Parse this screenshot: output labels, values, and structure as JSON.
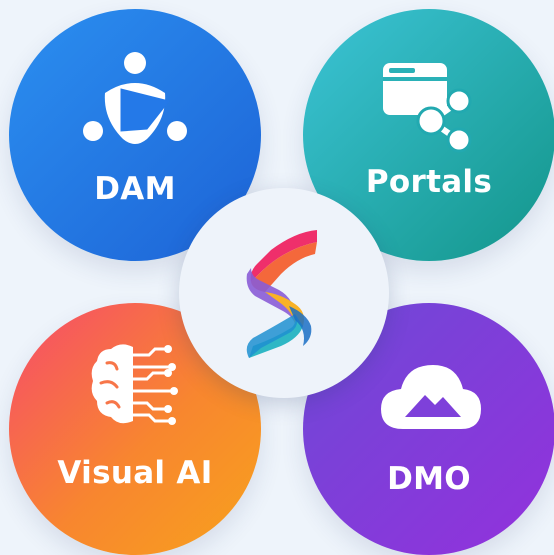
{
  "nodes": {
    "dam": {
      "label": "DAM",
      "icon": "people-play-icon"
    },
    "portals": {
      "label": "Portals",
      "icon": "browser-share-icon"
    },
    "visual_ai": {
      "label": "Visual AI",
      "icon": "brain-circuit-icon"
    },
    "dmo": {
      "label": "DMO",
      "icon": "cloud-image-icon"
    }
  },
  "center": {
    "icon": "brand-s-logo"
  },
  "colors": {
    "background": "#eef4fb",
    "dam": [
      "#2b8ff0",
      "#1d63d6"
    ],
    "portals": [
      "#3cc4d6",
      "#13958a"
    ],
    "visual_ai": [
      "#f64a6c",
      "#f8862f",
      "#f7a21c"
    ],
    "dmo": [
      "#6e49d6",
      "#9331dc"
    ]
  }
}
